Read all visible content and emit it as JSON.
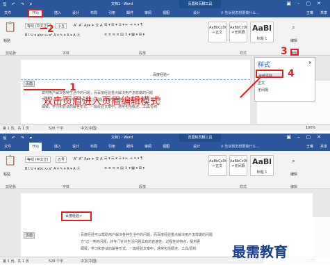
{
  "app": {
    "doc_title": "文档1 - Word",
    "context_title": "页眉和页脚工具",
    "tabs": [
      "文件",
      "开始",
      "插入",
      "设计",
      "布局",
      "引用",
      "邮件",
      "审阅",
      "视图",
      "设计"
    ],
    "tell_me": "♀ 告诉我您想要做什么...",
    "user": "王琳",
    "share": "共享"
  },
  "ribbon": {
    "font_name_1": "等线 (中文正)",
    "font_size_1": "小五",
    "font_name_2": "等线 (中文正)",
    "font_size_2": "五号",
    "styles": [
      "AaBbCcDt",
      "AaBbCcDt",
      "AaBl"
    ],
    "style_names": [
      "↵正文",
      "↵无间隔",
      "标题 1"
    ],
    "groups": [
      "剪贴板",
      "字体",
      "段落",
      "样式",
      "编辑"
    ],
    "paste": "粘贴",
    "edit": "编辑"
  },
  "screen1": {
    "header_text": "百度经验↵",
    "instruction": "双击页眉进入页眉编辑模式",
    "header_tag": "页眉",
    "pane_title": "样式",
    "pane_items": [
      "全部清除",
      "正文",
      "无间隔"
    ],
    "body_lines": [
      "如何用户解决各种生活中的问题，而百度经验重点解决用户怎样做的问题",
      "方\"过一类的问题，并专门针对生活问题具有的普遍性，过程性的特点，提供更",
      "细致，学习和尝试的解答形式。一篇经验文章中，通常包括概述、工具/原料"
    ],
    "annotations": [
      "1",
      "2",
      "3",
      "4"
    ]
  },
  "screen2": {
    "header_text": "百度经验↵",
    "header_tag": "页眉",
    "body_lines": [
      "百度经验可以帮助用户解决各种生活中的问题，而百度经验重点解决用户怎样做的问题",
      "方\"过一类的问题，并专门针对生活问题具有的普遍性，过程性的特点，提供更",
      "细致，学习和尝试的解答形式。一篇经验文章中，通常包括概述、工具/原料"
    ]
  },
  "status": {
    "page": "第 1 页，共 1 页",
    "words": "528 个字",
    "lang": "中文(中国)",
    "zoom": "100%"
  },
  "watermark": "最需教育",
  "colors": {
    "accent": "#2b579a",
    "annotation": "#e02020",
    "watermark": "#1a3e8c"
  }
}
